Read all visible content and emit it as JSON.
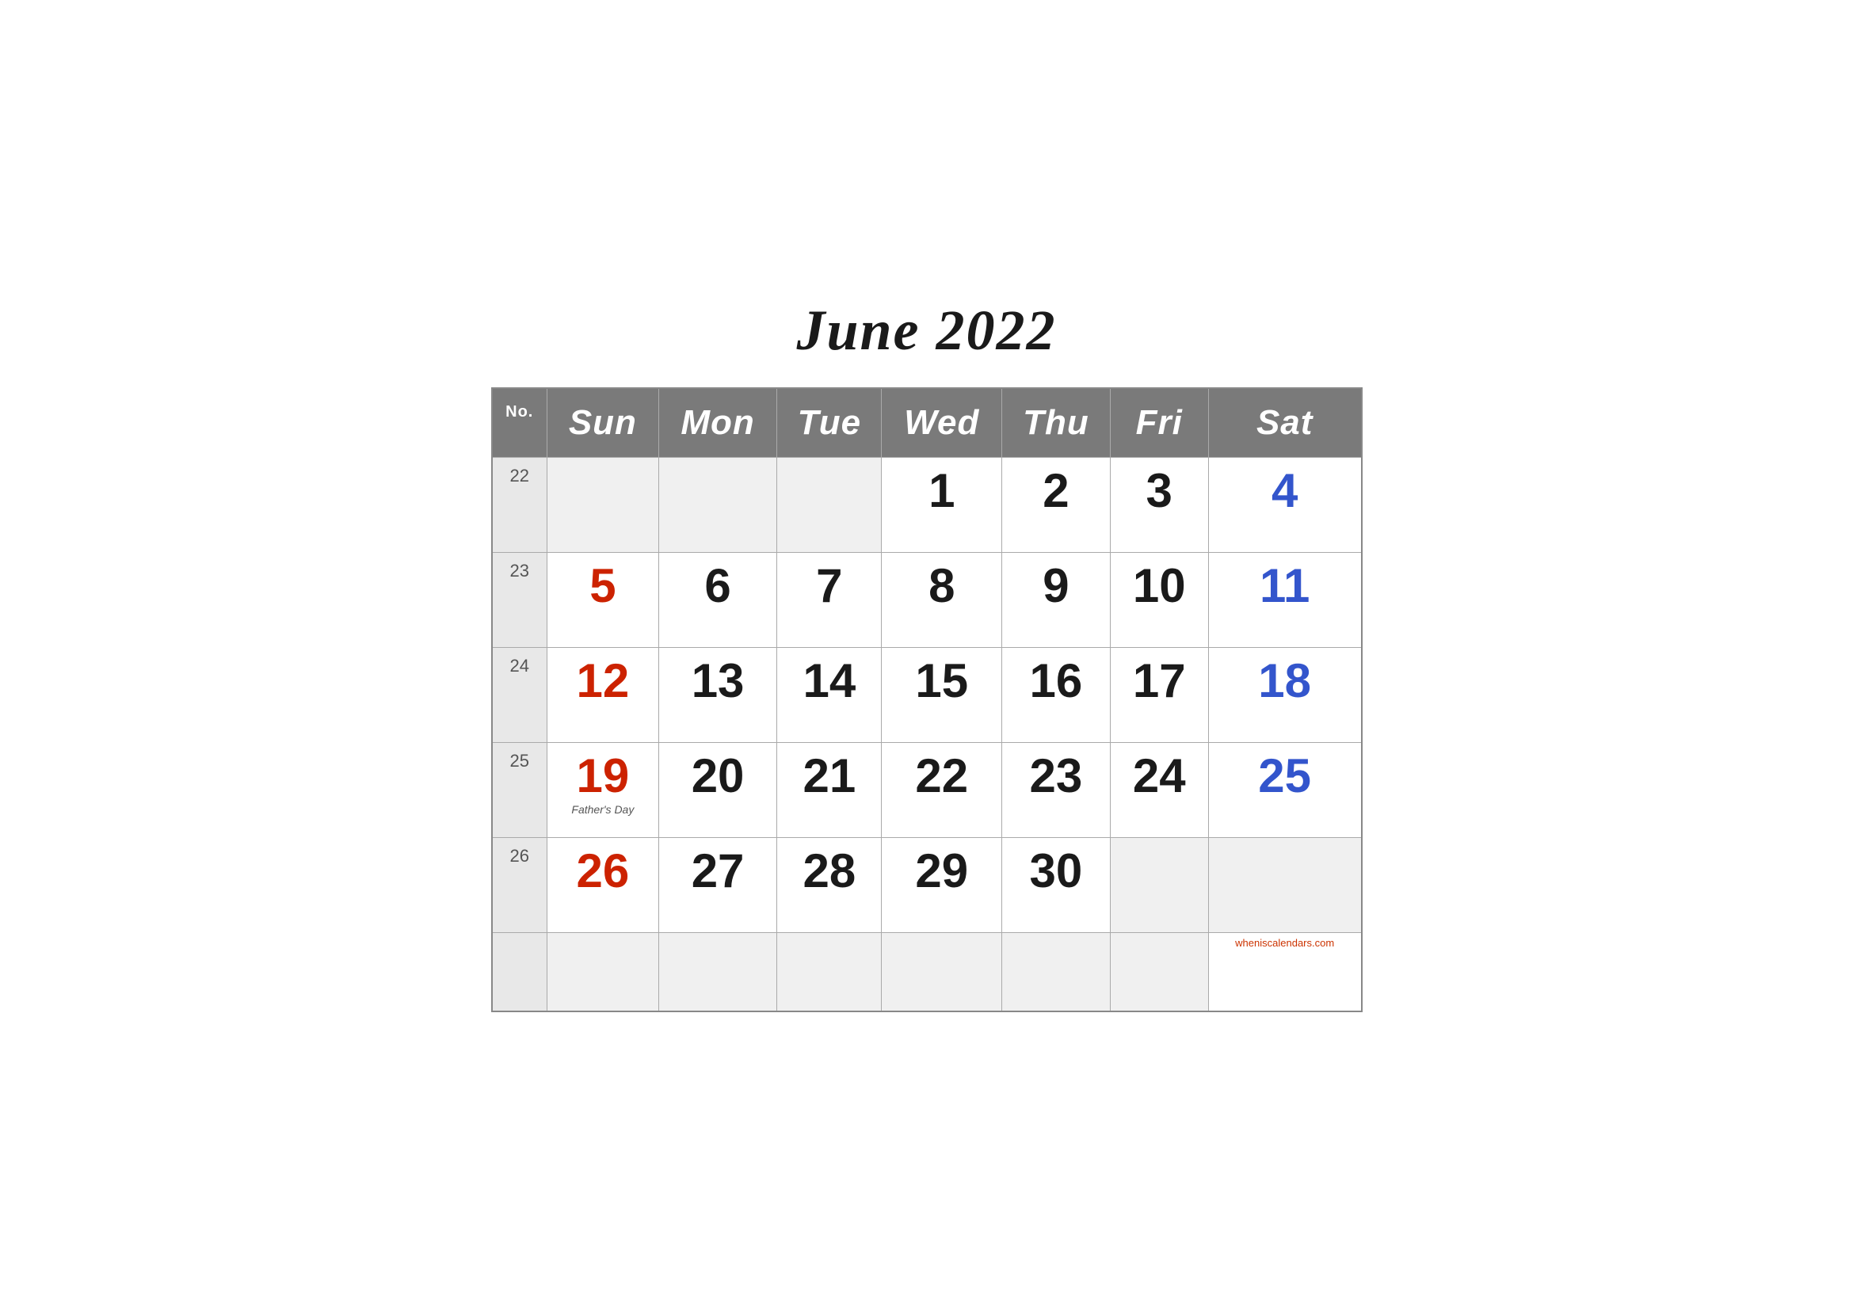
{
  "title": "June 2022",
  "headers": {
    "no": "No.",
    "sun": "Sun",
    "mon": "Mon",
    "tue": "Tue",
    "wed": "Wed",
    "thu": "Thu",
    "fri": "Fri",
    "sat": "Sat"
  },
  "weeks": [
    {
      "week_num": "22",
      "days": [
        {
          "num": "",
          "color": "black",
          "label": "",
          "empty": true
        },
        {
          "num": "",
          "color": "black",
          "label": "",
          "empty": true
        },
        {
          "num": "",
          "color": "black",
          "label": "",
          "empty": true
        },
        {
          "num": "1",
          "color": "black",
          "label": ""
        },
        {
          "num": "2",
          "color": "black",
          "label": ""
        },
        {
          "num": "3",
          "color": "black",
          "label": ""
        },
        {
          "num": "4",
          "color": "blue",
          "label": ""
        }
      ]
    },
    {
      "week_num": "23",
      "days": [
        {
          "num": "5",
          "color": "red",
          "label": ""
        },
        {
          "num": "6",
          "color": "black",
          "label": ""
        },
        {
          "num": "7",
          "color": "black",
          "label": ""
        },
        {
          "num": "8",
          "color": "black",
          "label": ""
        },
        {
          "num": "9",
          "color": "black",
          "label": ""
        },
        {
          "num": "10",
          "color": "black",
          "label": ""
        },
        {
          "num": "11",
          "color": "blue",
          "label": ""
        }
      ]
    },
    {
      "week_num": "24",
      "days": [
        {
          "num": "12",
          "color": "red",
          "label": ""
        },
        {
          "num": "13",
          "color": "black",
          "label": ""
        },
        {
          "num": "14",
          "color": "black",
          "label": ""
        },
        {
          "num": "15",
          "color": "black",
          "label": ""
        },
        {
          "num": "16",
          "color": "black",
          "label": ""
        },
        {
          "num": "17",
          "color": "black",
          "label": ""
        },
        {
          "num": "18",
          "color": "blue",
          "label": ""
        }
      ]
    },
    {
      "week_num": "25",
      "days": [
        {
          "num": "19",
          "color": "red",
          "label": "Father's Day"
        },
        {
          "num": "20",
          "color": "black",
          "label": ""
        },
        {
          "num": "21",
          "color": "black",
          "label": ""
        },
        {
          "num": "22",
          "color": "black",
          "label": ""
        },
        {
          "num": "23",
          "color": "black",
          "label": ""
        },
        {
          "num": "24",
          "color": "black",
          "label": ""
        },
        {
          "num": "25",
          "color": "blue",
          "label": ""
        }
      ]
    },
    {
      "week_num": "26",
      "days": [
        {
          "num": "26",
          "color": "red",
          "label": ""
        },
        {
          "num": "27",
          "color": "black",
          "label": ""
        },
        {
          "num": "28",
          "color": "black",
          "label": ""
        },
        {
          "num": "29",
          "color": "black",
          "label": ""
        },
        {
          "num": "30",
          "color": "black",
          "label": ""
        },
        {
          "num": "",
          "color": "black",
          "label": "",
          "empty": true
        },
        {
          "num": "",
          "color": "black",
          "label": "",
          "empty": true
        }
      ]
    }
  ],
  "watermark": "wheniscalendars.com"
}
